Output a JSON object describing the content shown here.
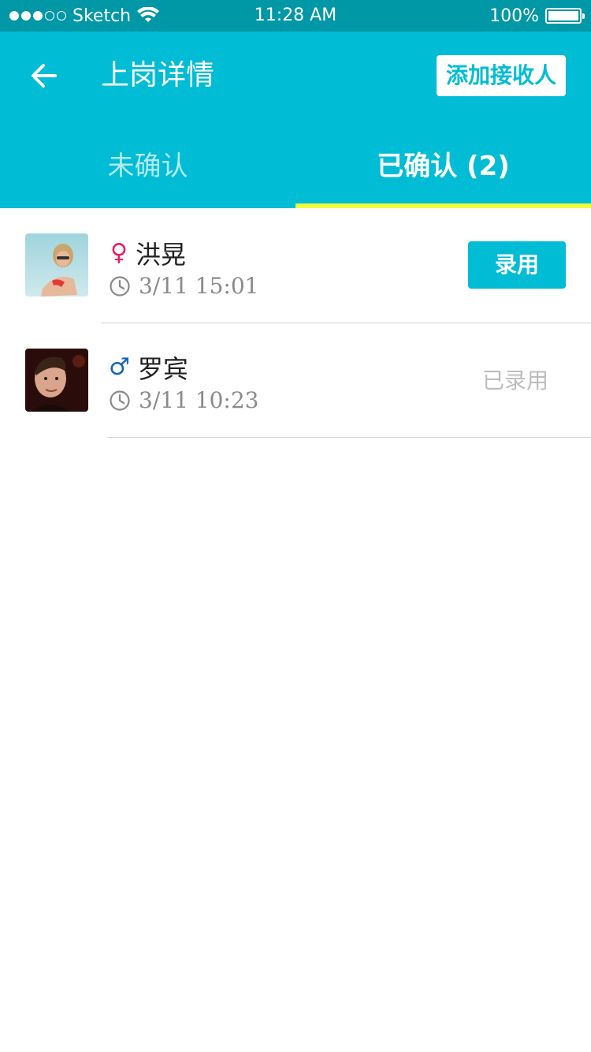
{
  "status_bar": {
    "carrier": "Sketch",
    "time": "11:28 AM",
    "battery": "100%",
    "signal_dots_filled": 3,
    "signal_dots_total": 5,
    "icons": [
      "signal-dots-icon",
      "wifi-icon",
      "battery-icon"
    ]
  },
  "header": {
    "title": "上岗详情",
    "add_button": "添加接收人",
    "back_icon": "arrow-left-icon"
  },
  "tabs": [
    {
      "label": "未确认",
      "active": false
    },
    {
      "label": "已确认 (2)",
      "active": true
    }
  ],
  "candidates": [
    {
      "name": "洪晃",
      "gender": "female",
      "gender_symbol": "♀",
      "gender_color": "#e91e63",
      "time": "3/11  15:01",
      "action_label": "录用",
      "action_type": "button"
    },
    {
      "name": "罗宾",
      "gender": "male",
      "gender_symbol": "♂",
      "gender_color": "#1565c0",
      "time": "3/11  10:23",
      "action_label": "已录用",
      "action_type": "status"
    }
  ],
  "colors": {
    "primary": "#00bcd4",
    "status_bar": "#0097a7",
    "tab_indicator": "#eeff41",
    "muted_text": "#8a8a8a",
    "disabled_text": "#bdbdbd"
  }
}
